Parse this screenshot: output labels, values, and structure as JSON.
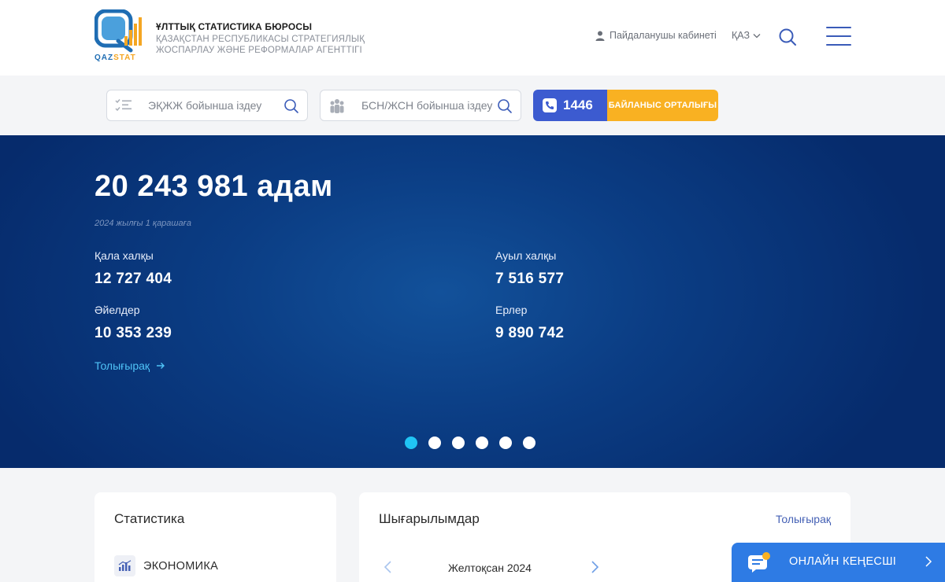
{
  "header": {
    "logo_text_a": "QAZ",
    "logo_text_b": "STAT",
    "org_title": "ҰЛТТЫҚ СТАТИСТИКА БЮРОСЫ",
    "org_sub_1": "ҚАЗАҚСТАН РЕСПУБЛИКАСЫ СТРАТЕГИЯЛЫҚ",
    "org_sub_2": "ЖОСПАРЛАУ ЖӘНЕ РЕФОРМАЛАР АГЕНТТІГІ",
    "cabinet": "Пайдаланушы кабинеті",
    "lang": "ҚАЗ"
  },
  "search": {
    "eqjj_placeholder": "ЭҚЖЖ бойынша іздеу",
    "bsn_placeholder": "БСН/ЖСН бойынша іздеу",
    "phone": "1446",
    "contact_label": "БАЙЛАНЫС ОРТАЛЫҒЫ"
  },
  "hero": {
    "population": "20 243 981 адам",
    "date": "2024 жылғы 1 қарашаға",
    "urban_label": "Қала халқы",
    "urban_value": "12 727 404",
    "rural_label": "Ауыл халқы",
    "rural_value": "7 516 577",
    "women_label": "Әйелдер",
    "women_value": "10 353 239",
    "men_label": "Ерлер",
    "men_value": "9 890 742",
    "more": "Толығырақ"
  },
  "stats_card": {
    "title": "Статистика",
    "item": "ЭКОНОМИКА"
  },
  "releases_card": {
    "title": "Шығарылымдар",
    "more": "Толығырақ",
    "month": "Желтоқсан 2024"
  },
  "chat": {
    "label": "ОНЛАЙН КЕҢЕСШІ"
  },
  "colors": {
    "accent": "#3c5bd0",
    "contact_orange": "#f9b122",
    "dot_active": "#20c4f4",
    "chat_blue": "#2e7be4"
  }
}
